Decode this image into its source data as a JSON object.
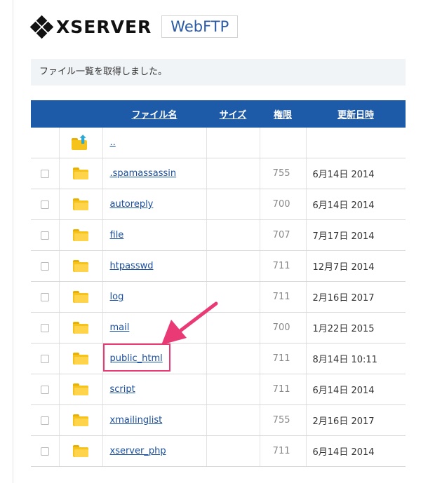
{
  "header": {
    "logo_text": "XSERVER",
    "product": "WebFTP"
  },
  "message": "ファイル一覧を取得しました。",
  "columns": {
    "name": "ファイル名",
    "size": "サイズ",
    "perm": "権限",
    "date": "更新日時"
  },
  "parent_link": "..",
  "files": [
    {
      "name": ".spamassassin",
      "perm": "755",
      "date": "6月14日 2014"
    },
    {
      "name": "autoreply",
      "perm": "700",
      "date": "6月14日 2014"
    },
    {
      "name": "file",
      "perm": "707",
      "date": "7月17日 2014"
    },
    {
      "name": "htpasswd",
      "perm": "711",
      "date": "12月7日 2014"
    },
    {
      "name": "log",
      "perm": "711",
      "date": "2月16日 2017"
    },
    {
      "name": "mail",
      "perm": "700",
      "date": "1月22日 2015"
    },
    {
      "name": "public_html",
      "perm": "711",
      "date": "8月14日 10:11"
    },
    {
      "name": "script",
      "perm": "711",
      "date": "6月14日 2014"
    },
    {
      "name": "xmailinglist",
      "perm": "755",
      "date": "2月16日 2017"
    },
    {
      "name": "xserver_php",
      "perm": "711",
      "date": "6月14日 2014"
    }
  ],
  "colors": {
    "header_bg": "#1d5aa8",
    "link": "#1a4fa0",
    "folder": "#f6c21c",
    "highlight": "#ea3a76"
  },
  "icons": {
    "folder": "folder-icon",
    "parent": "folder-up-icon",
    "logo": "xserver-logo-icon"
  }
}
